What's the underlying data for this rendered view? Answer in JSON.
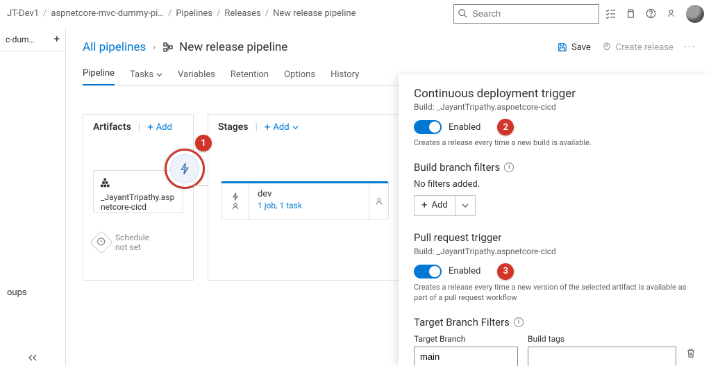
{
  "breadcrumb": [
    "JT-Dev1",
    "aspnetcore-mvc-dummy-pi…",
    "Pipelines",
    "Releases",
    "New release pipeline"
  ],
  "search": {
    "placeholder": "Search"
  },
  "leftnav": {
    "tab_label": "c-dum…",
    "item_groups": "oups"
  },
  "title": {
    "all_pipelines": "All pipelines",
    "pipeline_name": "New release pipeline",
    "save": "Save",
    "create_release": "Create release"
  },
  "tabs": {
    "pipeline": "Pipeline",
    "tasks": "Tasks",
    "variables": "Variables",
    "retention": "Retention",
    "options": "Options",
    "history": "History"
  },
  "artifacts": {
    "header": "Artifacts",
    "add": "Add",
    "card_name": "_JayantTripathy.aspnetcore-cicd",
    "schedule_label": "Schedule",
    "schedule_status": "not set"
  },
  "stages": {
    "header": "Stages",
    "add": "Add",
    "stage_name": "dev",
    "stage_jobs": "1 job, 1 task"
  },
  "callouts": {
    "c1": "1",
    "c2": "2",
    "c3": "3"
  },
  "panel": {
    "cdt_title": "Continuous deployment trigger",
    "cdt_build": "Build: _JayantTripathy.aspnetcore-cicd",
    "cdt_enabled": "Enabled",
    "cdt_desc": "Creates a release every time a new build is available.",
    "bbf_title": "Build branch filters",
    "bbf_empty": "No filters added.",
    "bbf_add": "Add",
    "prt_title": "Pull request trigger",
    "prt_build": "Build: _JayantTripathy.aspnetcore-cicd",
    "prt_enabled": "Enabled",
    "prt_desc": "Creates a release every time a new version of the selected artifact is available as part of a pull request workflow",
    "tbf_title": "Target Branch Filters",
    "tbf_branch_label": "Target Branch",
    "tbf_branch_value": "main",
    "tbf_tags_label": "Build tags",
    "tbf_tags_value": ""
  }
}
